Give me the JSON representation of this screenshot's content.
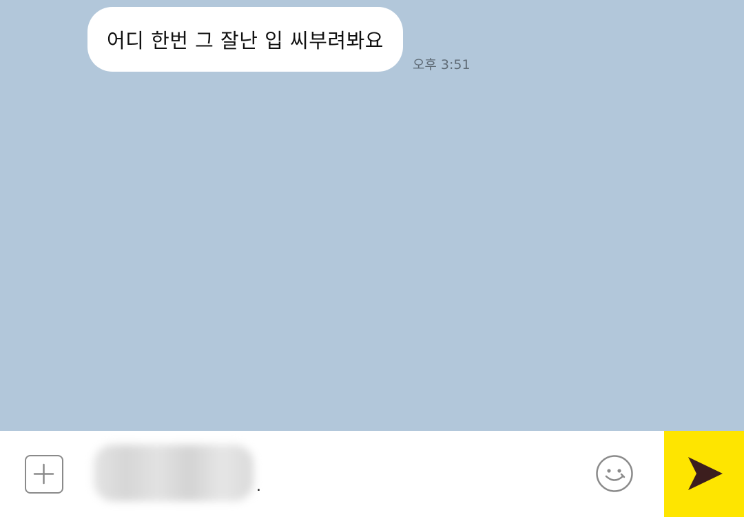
{
  "chat": {
    "messages": [
      {
        "text": "어디 한번 그 잘난 입 씨부려봐요",
        "time": "오후 3:51"
      }
    ]
  },
  "composer": {
    "value": "",
    "trailing_char": "."
  },
  "colors": {
    "chat_background": "#b2c7da",
    "bubble": "#ffffff",
    "send_button": "#fee500",
    "send_icon": "#3c1e1e",
    "icon_gray": "#8a8a8a"
  },
  "icons": {
    "attach": "plus-square-icon",
    "emoji": "smiley-icon",
    "send": "paper-plane-icon"
  }
}
